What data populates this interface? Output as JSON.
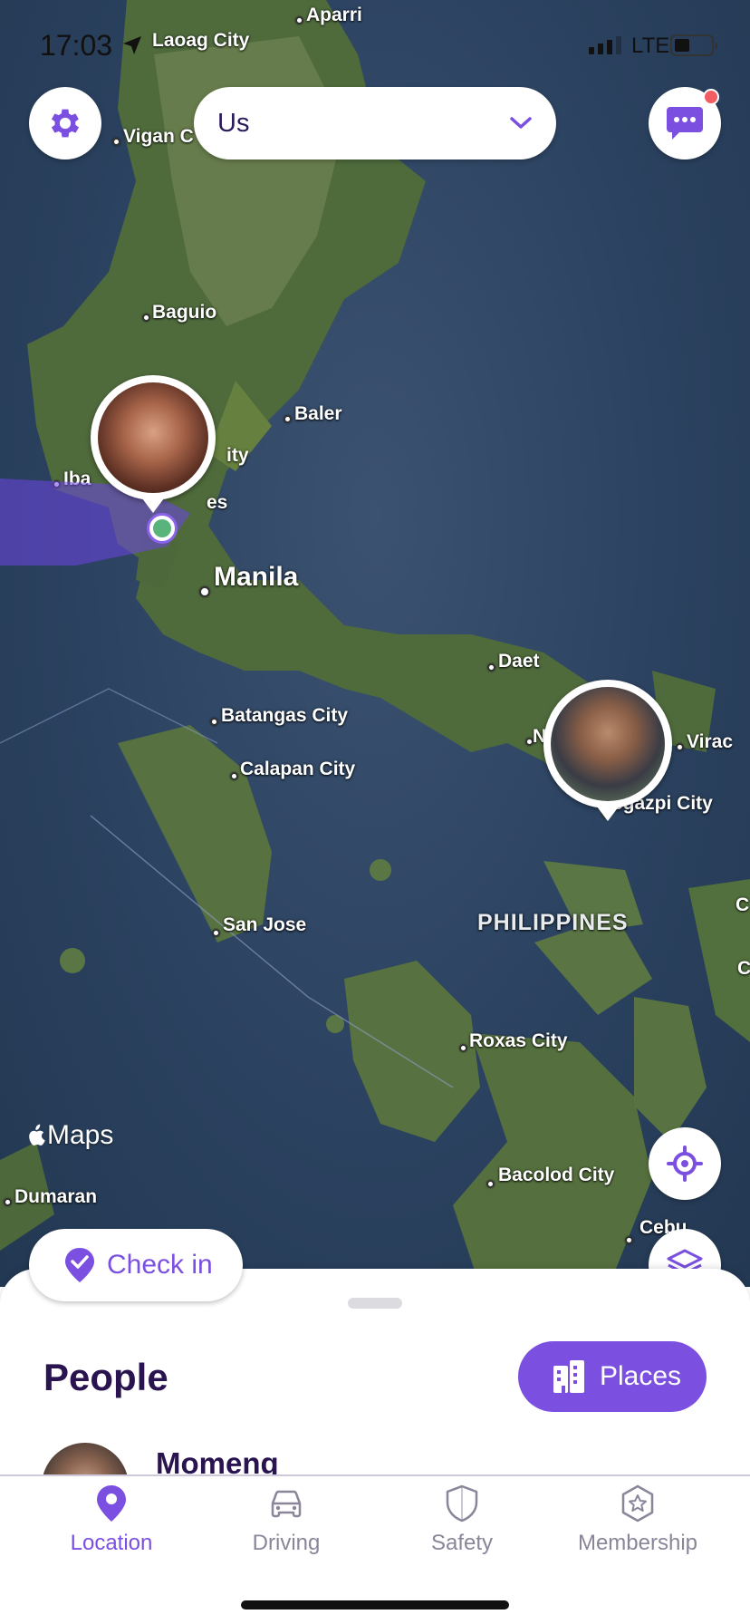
{
  "status_bar": {
    "time": "17:03",
    "network": "LTE"
  },
  "circle_selector": {
    "label": "Us"
  },
  "map": {
    "places": {
      "aparri": "Aparri",
      "laoag": "Laoag City",
      "vigan": "Vigan C",
      "baguio": "Baguio",
      "baler": "Baler",
      "iba": "Iba",
      "city_fragment": "ity",
      "es_fragment": "es",
      "manila": "Manila",
      "daet": "Daet",
      "batangas": "Batangas City",
      "calapan": "Calapan City",
      "n_fragment": "N",
      "virac": "Virac",
      "legazpi": "egazpi City",
      "philippines": "PHILIPPINES",
      "san_jose": "San Jose",
      "roxas": "Roxas City",
      "dumaran": "Dumaran",
      "bacolod": "Bacolod City",
      "cebu": "Cebu",
      "c1": "C",
      "c2": "C"
    },
    "attribution": "Maps"
  },
  "checkin": {
    "label": "Check in"
  },
  "sheet": {
    "title": "People",
    "places_button": "Places",
    "people": [
      {
        "name": "Momeng"
      }
    ]
  },
  "tabs": [
    {
      "label": "Location",
      "icon": "location-pin-icon",
      "active": true
    },
    {
      "label": "Driving",
      "icon": "car-icon",
      "active": false
    },
    {
      "label": "Safety",
      "icon": "shield-icon",
      "active": false
    },
    {
      "label": "Membership",
      "icon": "star-badge-icon",
      "active": false
    }
  ],
  "colors": {
    "brand": "#7b4fe0",
    "title": "#2a1450",
    "notification": "#f35c60",
    "inactive_tab": "#8a8598"
  }
}
